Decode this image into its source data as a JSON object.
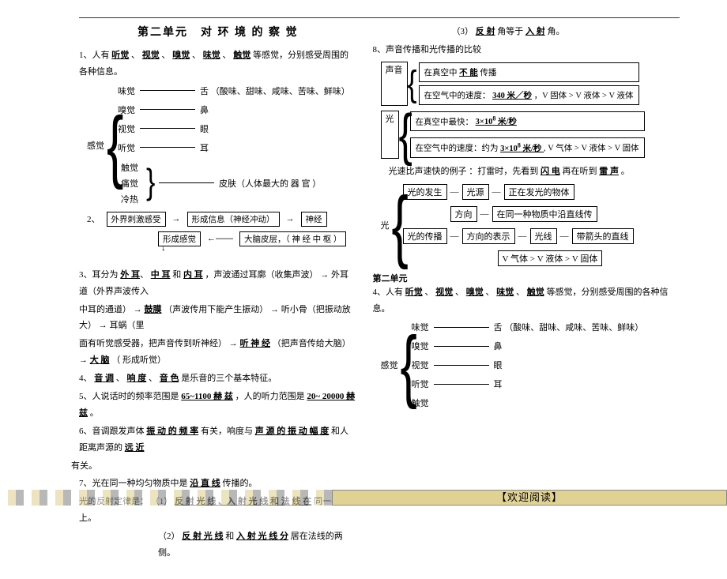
{
  "title": "第二单元　对 环 境 的 察 觉",
  "p1_prefix": "1、人有",
  "p1_senses": [
    "听觉",
    "视觉",
    "嗅觉",
    "味觉",
    "触觉"
  ],
  "p1_suffix": " 等感觉，分别感受周围的各种信息。",
  "sense_label": "感觉",
  "sense_rows": [
    {
      "left": "味觉",
      "right": "舌 （酸味、甜味、咸味、苦味、鲜味）"
    },
    {
      "left": "嗅觉",
      "right": "鼻"
    },
    {
      "left": "视觉",
      "right": "眼"
    },
    {
      "left": "听觉",
      "right": "耳"
    }
  ],
  "sense_group_left": [
    "触觉",
    "痛觉",
    "冷热"
  ],
  "sense_group_right": "皮肤（人体最大的 器 官 ）",
  "p2": {
    "num": "2、",
    "b1": "外界刺激感受",
    "b2": "形成信息（神经冲动）",
    "b3": "神经",
    "b4": "形成感觉",
    "b5": "大脑皮层，（ 神 经 中 枢 ）"
  },
  "p3": {
    "num": "3、耳分为",
    "parts": [
      "外 耳",
      "中 耳",
      "内 耳"
    ],
    "t1": "，声波通过耳廓（收集声波）",
    "t2": "外耳道（外界声波传入",
    "t3": "中耳的通道）",
    "t4": "鼓膜",
    "t5": "（声波传用下能产生振动）",
    "t6": "听小骨（把振动放大）",
    "t7": "耳蜗（里",
    "t8": "面有听觉感受器，把声音传到听神经）",
    "t9": "听 神 经",
    "t10": "（把声音传给大脑）",
    "t11": "大 脑",
    "t12": "（ 形成听觉）"
  },
  "p4": {
    "num": "4、",
    "a": "音 调",
    "b": "响 度",
    "c": "音 色",
    "suffix": " 是乐音的三个基本特征。"
  },
  "p5": {
    "num": "5、人说话时的频率范围是",
    "a": "65~1100 赫 兹",
    "mid": "，人的听力范围是",
    "b": "20~ 20000 赫 兹",
    "end": " 。"
  },
  "p6": {
    "num": "6、音调跟发声体",
    "a": "振 动 的 频 率",
    "mid": " 有关，响度与",
    "b": "声 源 的 振 动 幅 度",
    "mid2": " 和人距离声源的",
    "c": "远 近",
    "end": " 有关。"
  },
  "p7": {
    "num": "7、光在同一种均匀物质中是",
    "a": "沿 直 线",
    "suffix": " 传播的。"
  },
  "p8": {
    "head": "光的反射定律是：",
    "i1_num": "（1）",
    "i1": "反 射 光 线 、入 射 光 线 和 法 线 在",
    "i1_suf": " 同一平面上。",
    "i2_num": "（2）",
    "i2a": "反 射 光 线",
    "i2_mid": " 和 ",
    "i2b": "入 射 光 线 分",
    "i2_suf": " 居在法线的两侧。",
    "i3_num": "（3）",
    "i3a": "反 射",
    "i3_mid": " 角等于 ",
    "i3b": "入 射",
    "i3_suf": " 角。"
  },
  "p9": "8、声音传播和光传播的比较",
  "compare": {
    "sound_label": "声音",
    "sound1_a": "在真空中",
    "sound1_b": "不 能",
    "sound1_c": " 传播",
    "sound2": "在空气中的速度：",
    "sound2_u": "340 米／秒",
    "sound2_s": "，V 固体  > V 液体 >   V 液体",
    "light_label": "光",
    "light1_a": "在真空中最快：",
    "light1_u": "3×10",
    "light1_sup": "8",
    "light1_unit": "  米/秒",
    "light2_a": "在空气中的速度：约为",
    "light2_u": "3×10",
    "light2_sup": "8",
    "light2_unit": "  米/秒",
    "light2_s": " , V 气体 > V 液体 > V 固体"
  },
  "example": {
    "a": "光速比声速快的例子 ：打雷时，先看到",
    "u1": "闪 电",
    "b": "再在听到",
    "u2": "雷  声",
    "end": "。"
  },
  "light_diag": {
    "label": "光",
    "r1": {
      "a": "光的发生",
      "b": "光源",
      "c": "正在发光的物体"
    },
    "r1b": {
      "a": "方向",
      "b": "在同一种物质中沿直线传"
    },
    "r2": {
      "a": "光的传播",
      "b": "方向的表示",
      "c": "光线",
      "d": "带箭头的直线"
    },
    "r3": {
      "a": "V 气体 > V 液体 > V 固体"
    }
  },
  "sec2": "第二单元",
  "p4r_prefix": "4、人有",
  "p4r_suffix": " 等感觉，分别感受周围的各种信息。",
  "footer": "【欢迎阅读】"
}
